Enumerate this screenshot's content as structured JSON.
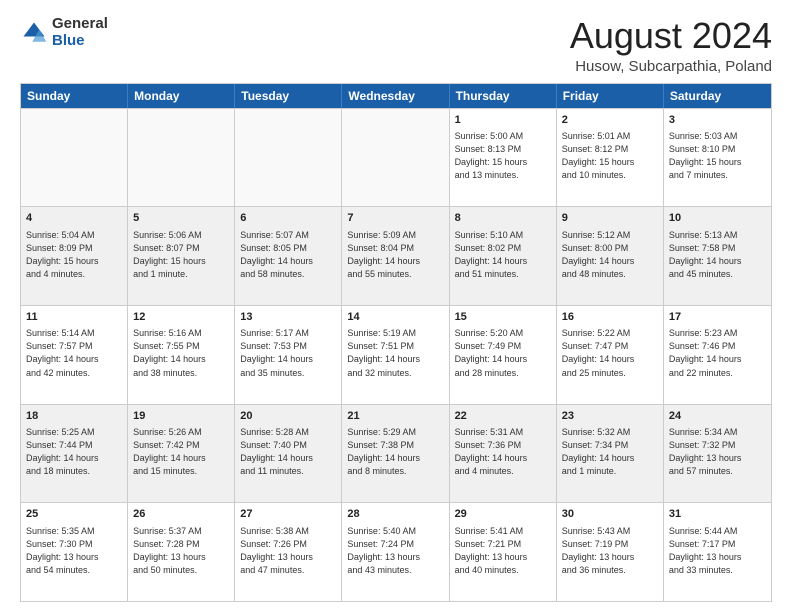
{
  "logo": {
    "general": "General",
    "blue": "Blue"
  },
  "title": "August 2024",
  "subtitle": "Husow, Subcarpathia, Poland",
  "days": [
    "Sunday",
    "Monday",
    "Tuesday",
    "Wednesday",
    "Thursday",
    "Friday",
    "Saturday"
  ],
  "rows": [
    [
      {
        "day": "",
        "text": "",
        "empty": true
      },
      {
        "day": "",
        "text": "",
        "empty": true
      },
      {
        "day": "",
        "text": "",
        "empty": true
      },
      {
        "day": "",
        "text": "",
        "empty": true
      },
      {
        "day": "1",
        "text": "Sunrise: 5:00 AM\nSunset: 8:13 PM\nDaylight: 15 hours\nand 13 minutes."
      },
      {
        "day": "2",
        "text": "Sunrise: 5:01 AM\nSunset: 8:12 PM\nDaylight: 15 hours\nand 10 minutes."
      },
      {
        "day": "3",
        "text": "Sunrise: 5:03 AM\nSunset: 8:10 PM\nDaylight: 15 hours\nand 7 minutes."
      }
    ],
    [
      {
        "day": "4",
        "text": "Sunrise: 5:04 AM\nSunset: 8:09 PM\nDaylight: 15 hours\nand 4 minutes."
      },
      {
        "day": "5",
        "text": "Sunrise: 5:06 AM\nSunset: 8:07 PM\nDaylight: 15 hours\nand 1 minute."
      },
      {
        "day": "6",
        "text": "Sunrise: 5:07 AM\nSunset: 8:05 PM\nDaylight: 14 hours\nand 58 minutes."
      },
      {
        "day": "7",
        "text": "Sunrise: 5:09 AM\nSunset: 8:04 PM\nDaylight: 14 hours\nand 55 minutes."
      },
      {
        "day": "8",
        "text": "Sunrise: 5:10 AM\nSunset: 8:02 PM\nDaylight: 14 hours\nand 51 minutes."
      },
      {
        "day": "9",
        "text": "Sunrise: 5:12 AM\nSunset: 8:00 PM\nDaylight: 14 hours\nand 48 minutes."
      },
      {
        "day": "10",
        "text": "Sunrise: 5:13 AM\nSunset: 7:58 PM\nDaylight: 14 hours\nand 45 minutes."
      }
    ],
    [
      {
        "day": "11",
        "text": "Sunrise: 5:14 AM\nSunset: 7:57 PM\nDaylight: 14 hours\nand 42 minutes."
      },
      {
        "day": "12",
        "text": "Sunrise: 5:16 AM\nSunset: 7:55 PM\nDaylight: 14 hours\nand 38 minutes."
      },
      {
        "day": "13",
        "text": "Sunrise: 5:17 AM\nSunset: 7:53 PM\nDaylight: 14 hours\nand 35 minutes."
      },
      {
        "day": "14",
        "text": "Sunrise: 5:19 AM\nSunset: 7:51 PM\nDaylight: 14 hours\nand 32 minutes."
      },
      {
        "day": "15",
        "text": "Sunrise: 5:20 AM\nSunset: 7:49 PM\nDaylight: 14 hours\nand 28 minutes."
      },
      {
        "day": "16",
        "text": "Sunrise: 5:22 AM\nSunset: 7:47 PM\nDaylight: 14 hours\nand 25 minutes."
      },
      {
        "day": "17",
        "text": "Sunrise: 5:23 AM\nSunset: 7:46 PM\nDaylight: 14 hours\nand 22 minutes."
      }
    ],
    [
      {
        "day": "18",
        "text": "Sunrise: 5:25 AM\nSunset: 7:44 PM\nDaylight: 14 hours\nand 18 minutes."
      },
      {
        "day": "19",
        "text": "Sunrise: 5:26 AM\nSunset: 7:42 PM\nDaylight: 14 hours\nand 15 minutes."
      },
      {
        "day": "20",
        "text": "Sunrise: 5:28 AM\nSunset: 7:40 PM\nDaylight: 14 hours\nand 11 minutes."
      },
      {
        "day": "21",
        "text": "Sunrise: 5:29 AM\nSunset: 7:38 PM\nDaylight: 14 hours\nand 8 minutes."
      },
      {
        "day": "22",
        "text": "Sunrise: 5:31 AM\nSunset: 7:36 PM\nDaylight: 14 hours\nand 4 minutes."
      },
      {
        "day": "23",
        "text": "Sunrise: 5:32 AM\nSunset: 7:34 PM\nDaylight: 14 hours\nand 1 minute."
      },
      {
        "day": "24",
        "text": "Sunrise: 5:34 AM\nSunset: 7:32 PM\nDaylight: 13 hours\nand 57 minutes."
      }
    ],
    [
      {
        "day": "25",
        "text": "Sunrise: 5:35 AM\nSunset: 7:30 PM\nDaylight: 13 hours\nand 54 minutes."
      },
      {
        "day": "26",
        "text": "Sunrise: 5:37 AM\nSunset: 7:28 PM\nDaylight: 13 hours\nand 50 minutes."
      },
      {
        "day": "27",
        "text": "Sunrise: 5:38 AM\nSunset: 7:26 PM\nDaylight: 13 hours\nand 47 minutes."
      },
      {
        "day": "28",
        "text": "Sunrise: 5:40 AM\nSunset: 7:24 PM\nDaylight: 13 hours\nand 43 minutes."
      },
      {
        "day": "29",
        "text": "Sunrise: 5:41 AM\nSunset: 7:21 PM\nDaylight: 13 hours\nand 40 minutes."
      },
      {
        "day": "30",
        "text": "Sunrise: 5:43 AM\nSunset: 7:19 PM\nDaylight: 13 hours\nand 36 minutes."
      },
      {
        "day": "31",
        "text": "Sunrise: 5:44 AM\nSunset: 7:17 PM\nDaylight: 13 hours\nand 33 minutes."
      }
    ]
  ]
}
